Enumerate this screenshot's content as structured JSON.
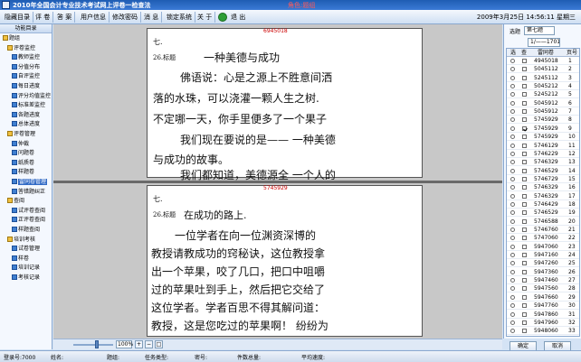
{
  "titlebar": {
    "title": "2010年全国会计专业技术考试网上评卷一检查法",
    "role": "角色:题组"
  },
  "menu": {
    "items": [
      "隐藏目录",
      "评 卷",
      "答 案",
      "用户信息",
      "修改密码",
      "消 息",
      "锁定系统",
      "关 于"
    ],
    "exit_label": "退 出"
  },
  "datetime": "2009年3月25日 14:56:11 星期三",
  "tree": {
    "header": "功能目录",
    "nodes": [
      {
        "label": "题组",
        "level": 0,
        "group": true
      },
      {
        "label": "评卷监控",
        "level": 1,
        "group": true
      },
      {
        "label": "教师监控",
        "level": 2
      },
      {
        "label": "分值分布",
        "level": 2
      },
      {
        "label": "自评监控",
        "level": 2
      },
      {
        "label": "每日进度",
        "level": 2
      },
      {
        "label": "评分均值监控",
        "level": 2
      },
      {
        "label": "标准差监控",
        "level": 2
      },
      {
        "label": "各题进度",
        "level": 2
      },
      {
        "label": "总体进度",
        "level": 2
      },
      {
        "label": "评卷管理",
        "level": 1,
        "group": true
      },
      {
        "label": "仲裁",
        "level": 2
      },
      {
        "label": "问题卷",
        "level": 2
      },
      {
        "label": "纸质卷",
        "level": 2
      },
      {
        "label": "样题卷",
        "level": 2
      },
      {
        "label": "雷同卷管理",
        "level": 2,
        "selected": true
      },
      {
        "label": "答错题纠正",
        "level": 2
      },
      {
        "label": "查阅",
        "level": 1,
        "group": true
      },
      {
        "label": "试评卷查阅",
        "level": 2
      },
      {
        "label": "正评卷查阅",
        "level": 2
      },
      {
        "label": "样题查阅",
        "level": 2
      },
      {
        "label": "培训考核",
        "level": 1,
        "group": true
      },
      {
        "label": "试卷管理",
        "level": 2
      },
      {
        "label": "样卷",
        "level": 2
      },
      {
        "label": "培训记录",
        "level": 2
      },
      {
        "label": "考核记录",
        "level": 2
      }
    ]
  },
  "viewer": {
    "page1": {
      "id": "6945018",
      "section": "七.",
      "qnum": "26.标题",
      "title": "一种美德与成功",
      "lines": [
        "佛语说：心是之源上不胜意间洒",
        "落的水珠，可以浇灌一颗人生之树.",
        "不定哪一天，你手里便多了一个果子",
        "我们现在要说的是—— 一种美德",
        "与成功的故事。",
        "我们都知道，美德源全 一个人的"
      ]
    },
    "page2": {
      "id": "5745929",
      "section": "七.",
      "qnum": "26.标题",
      "title": "在成功的路上.",
      "lines": [
        "一位学者在向一位渊资深博的",
        "教授请教成功的窍秘诀，这位教授拿",
        "出一个苹果，咬了几口，把口中咀嚼",
        "过的苹果吐到手上，然后把它交给了",
        "这位学者。学者百思不得其解问道：",
        "教授，这是您吃过的苹果啊！ 纷纷为"
      ]
    }
  },
  "zoom": {
    "value": "100%",
    "level": 0.6
  },
  "rightpanel": {
    "filter_label": "选题",
    "filter_value": "第七题",
    "range_value": "1/——1701",
    "columns": [
      "选",
      "查",
      "雷同卷",
      "页号"
    ],
    "rows": [
      {
        "id": "4945018",
        "page": "1",
        "checked": false
      },
      {
        "id": "5045112",
        "page": "2",
        "checked": false
      },
      {
        "id": "5245112",
        "page": "3",
        "checked": false
      },
      {
        "id": "5045212",
        "page": "4",
        "checked": false
      },
      {
        "id": "5245212",
        "page": "5",
        "checked": false
      },
      {
        "id": "5045912",
        "page": "6",
        "checked": false
      },
      {
        "id": "5045912",
        "page": "7",
        "checked": false
      },
      {
        "id": "5745929",
        "page": "8",
        "checked": false
      },
      {
        "id": "5745929",
        "page": "9",
        "checked": true
      },
      {
        "id": "5745929",
        "page": "10",
        "checked": false
      },
      {
        "id": "5746129",
        "page": "11",
        "checked": false
      },
      {
        "id": "5746229",
        "page": "12",
        "checked": false
      },
      {
        "id": "5746329",
        "page": "13",
        "checked": false
      },
      {
        "id": "5746529",
        "page": "14",
        "checked": false
      },
      {
        "id": "5746729",
        "page": "15",
        "checked": false
      },
      {
        "id": "5746329",
        "page": "16",
        "checked": false
      },
      {
        "id": "5746329",
        "page": "17",
        "checked": false
      },
      {
        "id": "5746429",
        "page": "18",
        "checked": false
      },
      {
        "id": "5746529",
        "page": "19",
        "checked": false
      },
      {
        "id": "5746588",
        "page": "20",
        "checked": false
      },
      {
        "id": "5746760",
        "page": "21",
        "checked": false
      },
      {
        "id": "5747060",
        "page": "22",
        "checked": false
      },
      {
        "id": "5947060",
        "page": "23",
        "checked": false
      },
      {
        "id": "5947160",
        "page": "24",
        "checked": false
      },
      {
        "id": "5947260",
        "page": "25",
        "checked": false
      },
      {
        "id": "5947360",
        "page": "26",
        "checked": false
      },
      {
        "id": "5947460",
        "page": "27",
        "checked": false
      },
      {
        "id": "5947560",
        "page": "28",
        "checked": false
      },
      {
        "id": "5947660",
        "page": "29",
        "checked": false
      },
      {
        "id": "5947760",
        "page": "30",
        "checked": false
      },
      {
        "id": "5947860",
        "page": "31",
        "checked": false
      },
      {
        "id": "5947960",
        "page": "32",
        "checked": false
      },
      {
        "id": "5948060",
        "page": "33",
        "checked": false
      }
    ],
    "ok_label": "确定",
    "cancel_label": "取消"
  },
  "status": {
    "login": "登录号:7000",
    "name": "姓名:",
    "group": "题组:",
    "task_type": "任务类型:",
    "secret": "密号:",
    "total": "件数总量:",
    "speed": "平均速度:"
  },
  "colors": {
    "titlebar": "#2a6bc5",
    "accent": "#316ac5",
    "qnum_red": "#dd0000"
  }
}
